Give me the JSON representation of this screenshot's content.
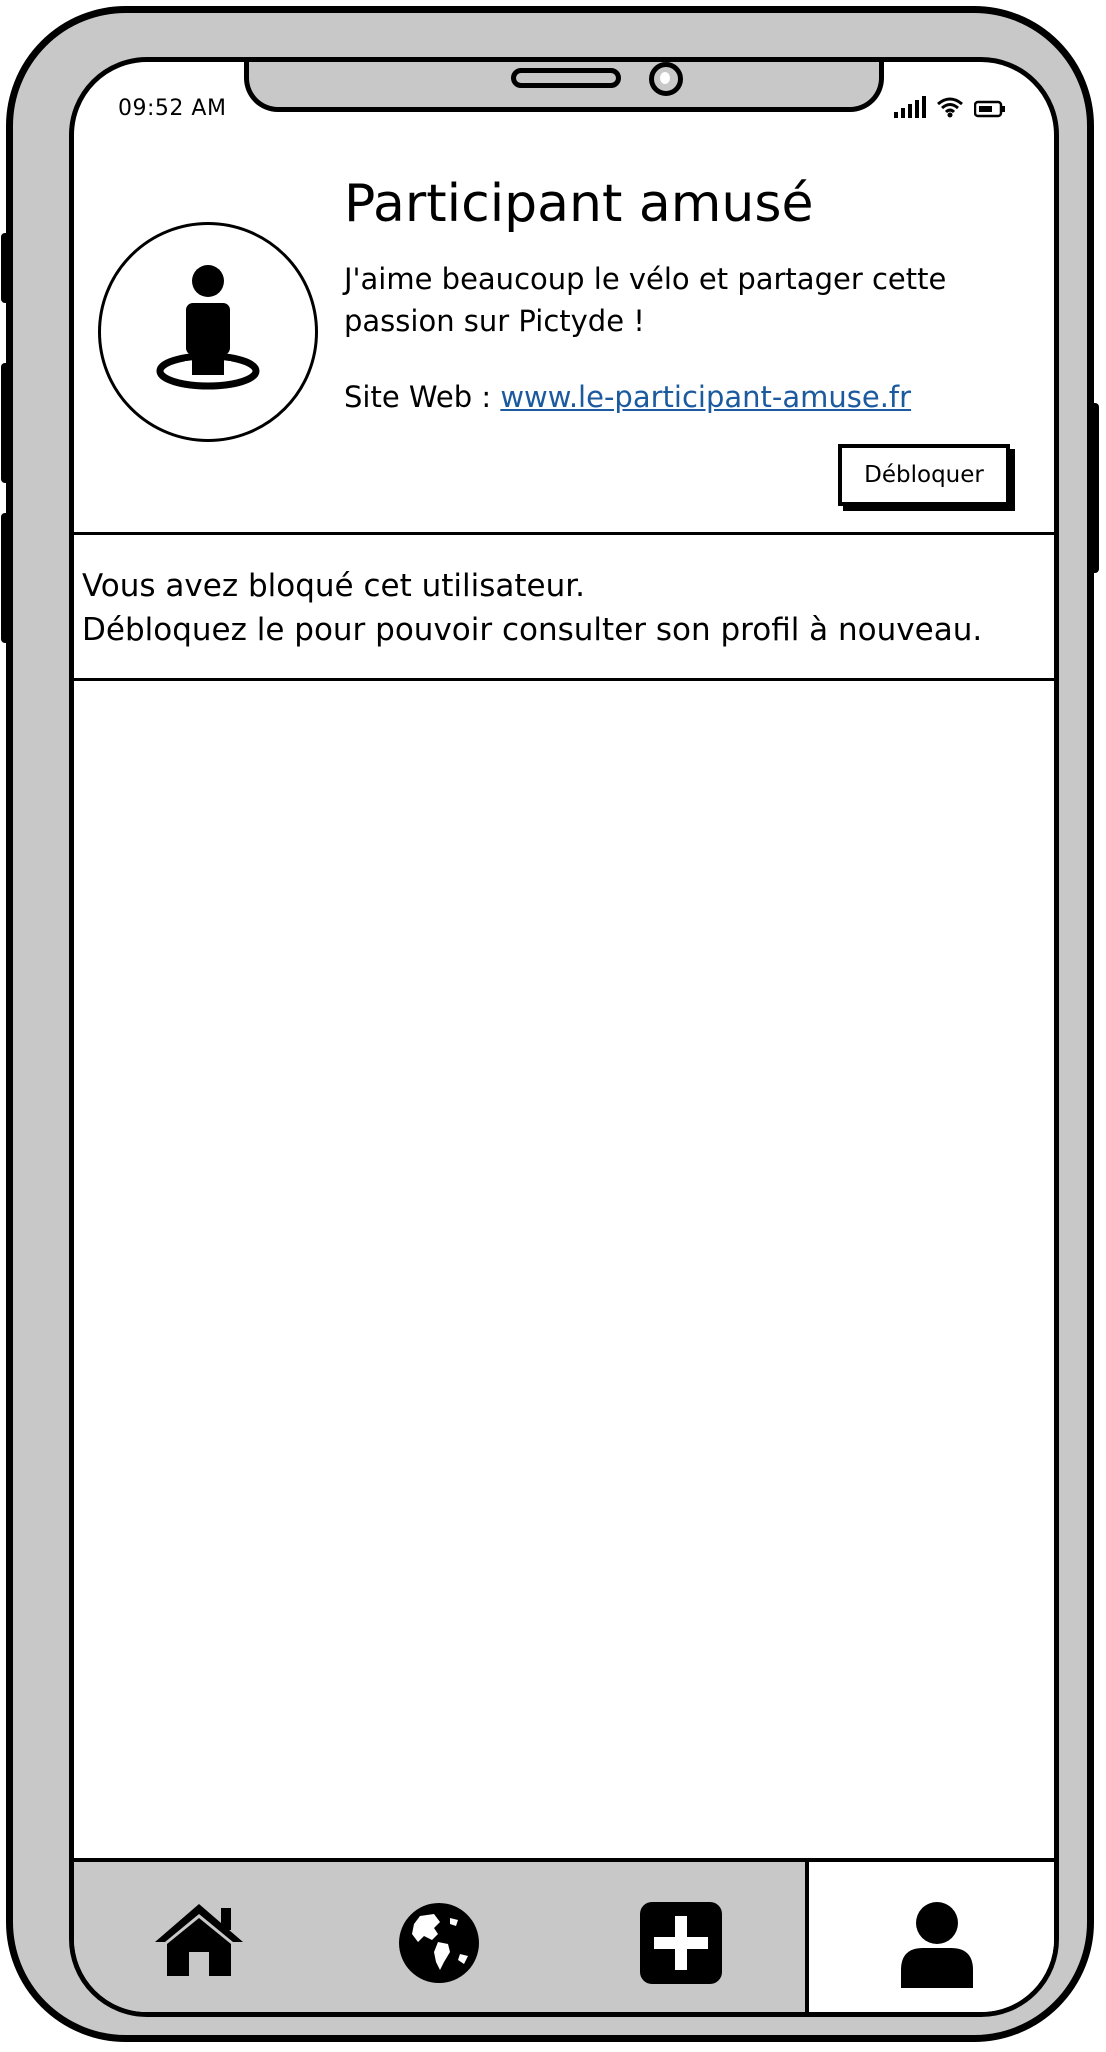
{
  "status_bar": {
    "time": "09:52 AM"
  },
  "profile": {
    "name": "Participant amusé",
    "bio_line1": "J'aime beaucoup le vélo et partager cette",
    "bio_line2": "passion sur Pictyde !",
    "website_label": "Site Web :",
    "website_url": "www.le-participant-amuse.fr",
    "unblock_label": "Débloquer"
  },
  "blocked_notice": {
    "line1": "Vous avez bloqué cet utilisateur.",
    "line2": "Débloquez le pour pouvoir consulter son profil à nouveau."
  },
  "tab_bar": {
    "tabs": [
      {
        "icon": "home-icon",
        "active": false
      },
      {
        "icon": "globe-icon",
        "active": false
      },
      {
        "icon": "plus-square-icon",
        "active": false
      },
      {
        "icon": "user-icon",
        "active": true
      }
    ]
  },
  "colors": {
    "link": "#1b5a9e",
    "frame": "#c8c8c8",
    "background": "#ffffff"
  }
}
